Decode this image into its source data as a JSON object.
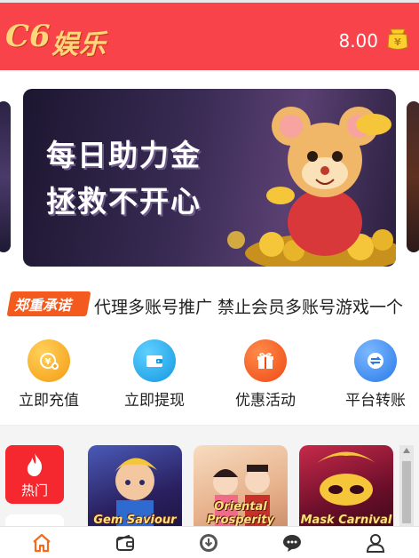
{
  "header": {
    "logo_text": "娱乐",
    "logo_mark": "C6",
    "balance": "8.00",
    "wallet_icon": "wallet-coin-icon"
  },
  "banner": {
    "line1": "每日助力金",
    "line2": "拯救不开心"
  },
  "notice": {
    "tag": "郑重承诺",
    "text": "代理多账号推广 禁止会员多账号游戏一个"
  },
  "actions": [
    {
      "label": "立即充值",
      "icon": "recharge-icon",
      "color": "#f7a21a"
    },
    {
      "label": "立即提现",
      "icon": "withdraw-wallet-icon",
      "color": "#1fa9ec"
    },
    {
      "label": "优惠活动",
      "icon": "gift-icon",
      "color": "#f2541e"
    },
    {
      "label": "平台转账",
      "icon": "transfer-icon",
      "color": "#3e8ef0"
    }
  ],
  "categories": [
    {
      "label": "热门",
      "icon": "flame-icon"
    }
  ],
  "games": [
    {
      "title": "Gem Saviour",
      "color": "#3b3a7a"
    },
    {
      "title": "Oriental Prosperity",
      "color": "#e9b98a"
    },
    {
      "title": "Mask Carnival",
      "color": "#8a1c3a"
    }
  ],
  "tabs": [
    {
      "icon": "home-icon",
      "active": true
    },
    {
      "icon": "wallet-icon",
      "active": false
    },
    {
      "icon": "download-icon",
      "active": false
    },
    {
      "icon": "chat-icon",
      "active": false
    },
    {
      "icon": "user-icon",
      "active": false
    }
  ],
  "colors": {
    "header_bg": "#f8434a",
    "accent": "#f26b1e",
    "hot_bg": "#f4282e"
  }
}
